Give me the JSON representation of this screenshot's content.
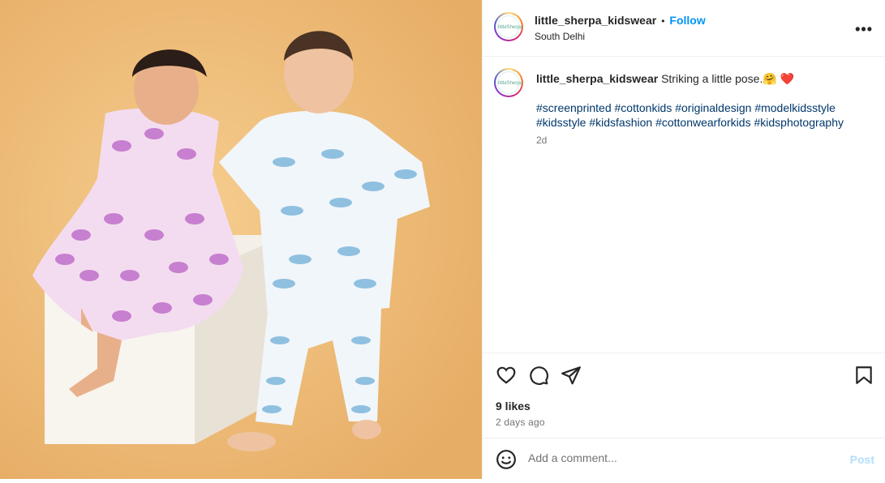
{
  "post": {
    "username": "little_sherpa_kidswear",
    "follow_label": "Follow",
    "separator": "•",
    "location": "South Delhi",
    "avatar_text": "littleSherpa",
    "more_label": "•••",
    "caption": "Striking a little pose.🤗 ",
    "caption_heart": "❤️",
    "hashtags": [
      "#screenprinted",
      "#cottonkids",
      "#originaldesign",
      "#modelkidsstyle",
      "#kidsstyle",
      "#kidsfashion",
      "#cottonwearforkids",
      "#kidsphotography"
    ],
    "caption_age": "2d",
    "likes": "9 likes",
    "posted": "2 days ago",
    "comment_placeholder": "Add a comment...",
    "post_label": "Post"
  },
  "icons": [
    "heart-icon",
    "comment-icon",
    "share-icon",
    "bookmark-icon",
    "emoji-icon",
    "more-icon"
  ],
  "colors": {
    "link": "#0095f6",
    "hashtag": "#00376b",
    "background_photo": "#efbd7a"
  }
}
